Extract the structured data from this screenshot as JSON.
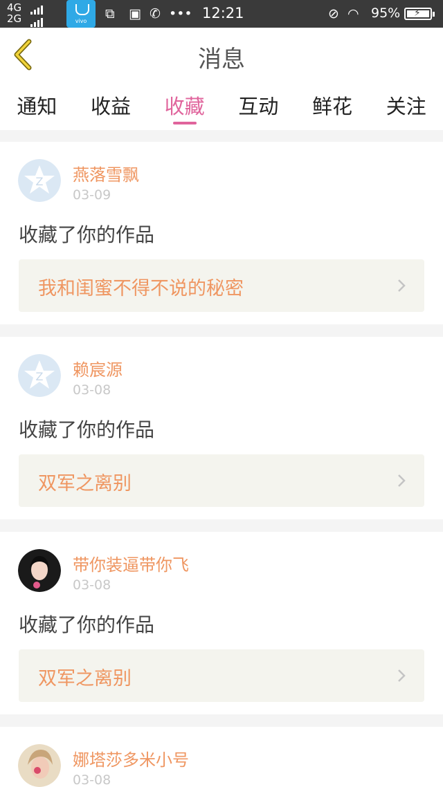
{
  "status_bar": {
    "net_top": "4G",
    "net_bottom": "2G",
    "store_label": "vivo",
    "time": "12:21",
    "battery": "95%",
    "icons": [
      "signal-icon",
      "app-store-icon",
      "screenshot-icon",
      "bag-icon",
      "phone-icon",
      "more-icon",
      "mute-icon",
      "wifi-icon",
      "battery-icon"
    ]
  },
  "header": {
    "title": "消息",
    "back_icon": "chevron-left-icon"
  },
  "tabs": [
    {
      "label": "通知",
      "active": false
    },
    {
      "label": "收益",
      "active": false
    },
    {
      "label": "收藏",
      "active": true
    },
    {
      "label": "互动",
      "active": false
    },
    {
      "label": "鲜花",
      "active": false
    },
    {
      "label": "关注",
      "active": false
    }
  ],
  "messages": [
    {
      "user": "燕落雪飘",
      "date": "03-09",
      "action": "收藏了你的作品",
      "work": "我和闺蜜不得不说的秘密",
      "avatar": "default-avatar-icon"
    },
    {
      "user": "赖宸源",
      "date": "03-08",
      "action": "收藏了你的作品",
      "work": "双军之离别",
      "avatar": "default-avatar-icon"
    },
    {
      "user": "带你装逼带你飞",
      "date": "03-08",
      "action": "收藏了你的作品",
      "work": "双军之离别",
      "avatar": "user-photo-avatar"
    },
    {
      "user": "娜塔莎多米小号",
      "date": "03-08",
      "action": "",
      "work": "",
      "avatar": "user-photo-avatar"
    }
  ],
  "colors": {
    "accent": "#e0649c",
    "username": "#ef9661",
    "status_bar": "#3a3a3a"
  }
}
